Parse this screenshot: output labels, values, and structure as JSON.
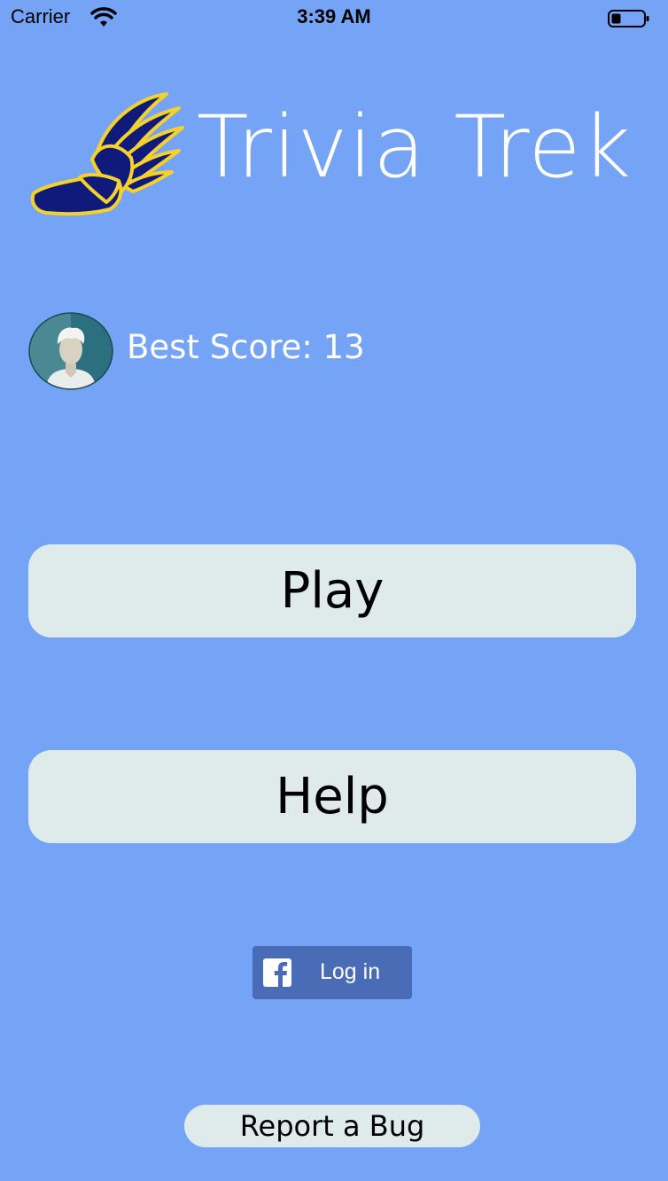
{
  "status_bar": {
    "carrier": "Carrier",
    "time": "3:39 AM",
    "wifi_icon": "wifi-icon",
    "battery_icon": "battery-icon"
  },
  "header": {
    "logo_icon": "winged-shoe-icon",
    "title": "Trivia Trek"
  },
  "profile": {
    "avatar_icon": "user-avatar-icon",
    "best_score_label": "Best Score: 13"
  },
  "buttons": {
    "play": "Play",
    "help": "Help"
  },
  "facebook": {
    "icon": "facebook-icon",
    "login_label": "Log in"
  },
  "footer": {
    "report_bug": "Report a Bug"
  },
  "colors": {
    "background": "#75a3f5",
    "button_bg": "#dfeaeb",
    "facebook_blue": "#4a6bb6",
    "logo_navy": "#101a7a",
    "logo_gold": "#f5d22b"
  }
}
